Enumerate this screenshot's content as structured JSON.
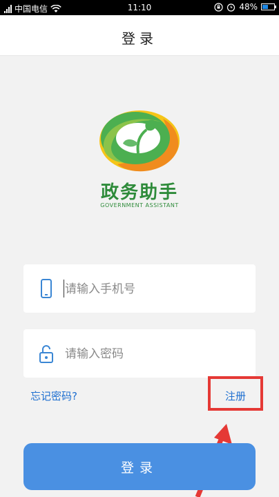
{
  "status_bar": {
    "carrier": "中国电信",
    "time": "11:10",
    "battery": "48%",
    "battery_level": 0.48,
    "icons": [
      "signal-icon",
      "wifi-icon",
      "lock-rotation-icon",
      "alarm-icon",
      "battery-icon"
    ]
  },
  "header": {
    "title": "登录"
  },
  "logo": {
    "name": "政务助手",
    "subtitle": "GOVERNMENT ASSISTANT",
    "colors": {
      "green": "#4caf50",
      "orange": "#f08c1e",
      "yellow": "#f5c518"
    }
  },
  "form": {
    "phone_placeholder": "请输入手机号",
    "password_placeholder": "请输入密码",
    "forgot_label": "忘记密码?",
    "register_label": "注册",
    "login_label": "登录"
  },
  "colors": {
    "accent": "#4a90e2",
    "link": "#1e6fd0",
    "highlight": "#e53935",
    "brand_text": "#2e8b3a"
  }
}
